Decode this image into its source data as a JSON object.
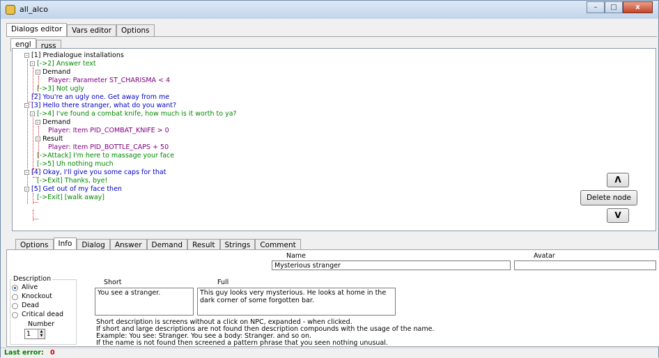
{
  "window": {
    "title": "all_alco",
    "min": "–",
    "max": "□",
    "close": "x"
  },
  "top_tabs": [
    "Dialogs editor",
    "Vars editor",
    "Options"
  ],
  "lang_tabs": [
    "engl",
    "russ"
  ],
  "tree": [
    {
      "text": "[1] Predialogue installations",
      "color": "black",
      "exp": "-"
    },
    {
      "text": "[->2] Answer text",
      "color": "answer",
      "exp": "-"
    },
    {
      "text": "Demand",
      "color": "black",
      "exp": "-"
    },
    {
      "text": "Player: Parameter ST_CHARISMA < 4",
      "color": "purple",
      "exp": ""
    },
    {
      "text": "[->3] Not ugly",
      "color": "answer",
      "exp": ""
    },
    {
      "text": "[2] You're an ugly one. Get away from me",
      "color": "dialog",
      "exp": ""
    },
    {
      "text": "[3] Hello there stranger, what do you want?",
      "color": "dialog",
      "exp": "-"
    },
    {
      "text": "[->4] I've found a combat knife, how much is it worth to ya?",
      "color": "answer",
      "exp": "-"
    },
    {
      "text": "Demand",
      "color": "black",
      "exp": "-"
    },
    {
      "text": "Player: Item PID_COMBAT_KNIFE > 0",
      "color": "purple",
      "exp": ""
    },
    {
      "text": "Result",
      "color": "black",
      "exp": "-"
    },
    {
      "text": "Player: Item PID_BOTTLE_CAPS + 50",
      "color": "purple",
      "exp": ""
    },
    {
      "text": "[->Attack] I'm here to massage your face",
      "color": "answer",
      "exp": ""
    },
    {
      "text": "[->5] Uh nothing much",
      "color": "answer",
      "exp": ""
    },
    {
      "text": "[4] Okay, I'll give you some caps for that",
      "color": "dialog",
      "exp": "-"
    },
    {
      "text": "[->Exit] Thanks, bye!",
      "color": "answer",
      "exp": ""
    },
    {
      "text": "[5] Get out of my face then",
      "color": "dialog",
      "exp": "-"
    },
    {
      "text": "[->Exit] [walk away]",
      "color": "answer",
      "exp": ""
    }
  ],
  "buttons": {
    "up": "Λ",
    "delete": "Delete node",
    "down": "V"
  },
  "bottom_tabs": [
    "Options",
    "Info",
    "Dialog",
    "Answer",
    "Demand",
    "Result",
    "Strings",
    "Comment"
  ],
  "info": {
    "name_label": "Name",
    "name_value": "Mysterious stranger",
    "avatar_label": "Avatar",
    "avatar_value": "",
    "description_label": "Description",
    "states": [
      "Alive",
      "Knockout",
      "Dead",
      "Critical dead"
    ],
    "selected_state": "Alive",
    "number_label": "Number",
    "number_value": "1",
    "short_label": "Short",
    "full_label": "Full",
    "short_value": "You see a stranger.",
    "full_value": "This guy looks very mysterious. He looks at home in the dark corner of some forgotten bar.",
    "help_lines": [
      "Short description is screens without a click on NPC, expanded - when clicked.",
      "If short and large descriptions are not found then description compounds with the usage of the name.",
      "Example: You see: Stranger. You see a body: Stranger. and so on.",
      "If the name is not found then screened a pattern phrase that you seen nothing unusual."
    ]
  },
  "status": {
    "label": "Last error:",
    "value": "0"
  },
  "colors": {
    "dialog": "#0000cc",
    "answer": "#008800",
    "demand": "#800080",
    "tree_line": "#dd2222",
    "status_green": "#008000",
    "error_red": "#cc0000"
  }
}
